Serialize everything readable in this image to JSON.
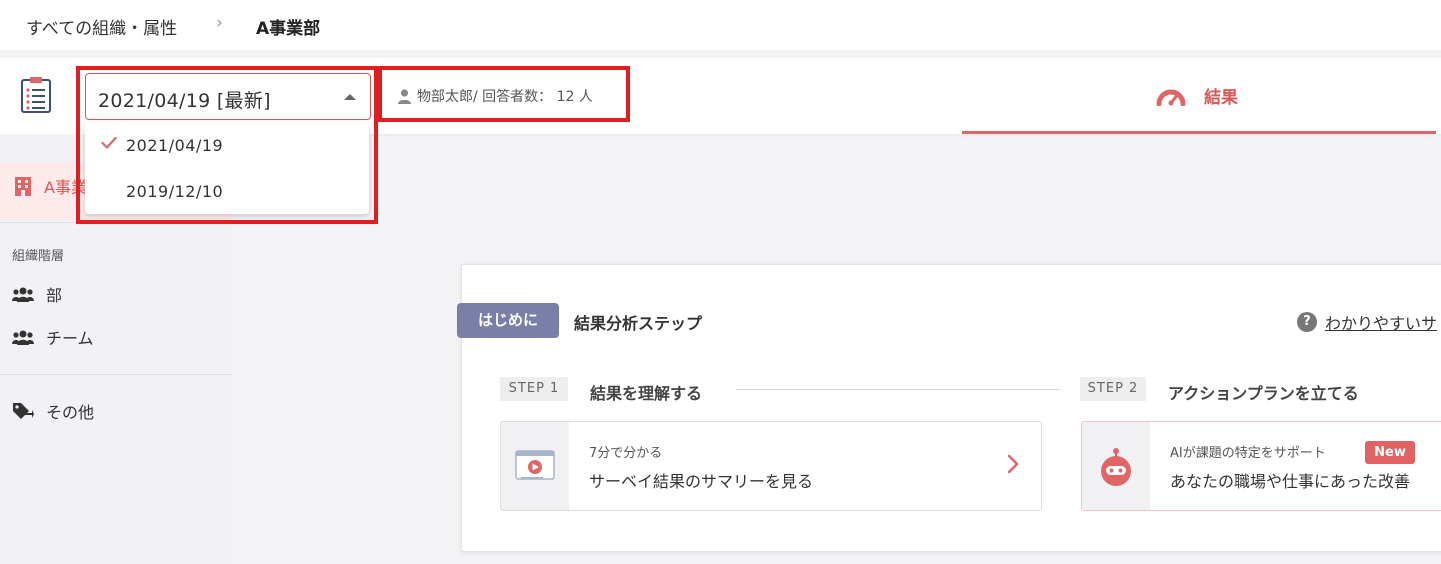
{
  "breadcrumb": {
    "parent": "すべての組織・属性",
    "separator": "›",
    "current": "A事業部"
  },
  "header": {
    "date_select_value": "2021/04/19 [最新]",
    "respondent_text": "物部太郎/ 回答者数： 12 人",
    "result_tab_label": "結果"
  },
  "dropdown": {
    "options": [
      {
        "label": "2021/04/19",
        "selected": true
      },
      {
        "label": "2019/12/10",
        "selected": false
      }
    ]
  },
  "sidebar": {
    "active_label": "A事業部",
    "heading": "組織階層",
    "items": [
      {
        "label": "部",
        "icon": "group-icon"
      },
      {
        "label": "チーム",
        "icon": "group-icon"
      }
    ],
    "other_label": "その他",
    "other_icon": "tag-icon"
  },
  "main": {
    "intro_badge": "はじめに",
    "title": "結果分析ステップ",
    "help_link": "わかりやすいサ",
    "step1": {
      "badge": "STEP 1",
      "title": "結果を理解する",
      "card_sub": "7分で分かる",
      "card_main": "サーベイ結果のサマリーを見る"
    },
    "step2": {
      "badge": "STEP 2",
      "title": "アクションプランを立てる",
      "card_sub": "AIが課題の特定をサポート",
      "card_badge": "New",
      "card_main": "あなたの職場や仕事にあった改善"
    }
  },
  "colors": {
    "accent": "#e06666",
    "highlight": "#e02020",
    "intro_badge": "#7a7fa8"
  }
}
